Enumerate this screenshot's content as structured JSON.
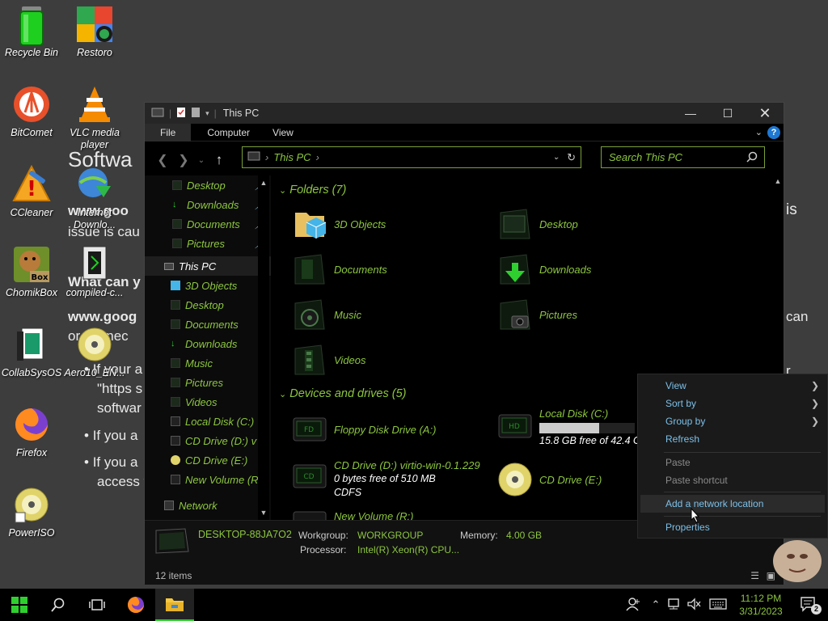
{
  "background": {
    "software": "Softwa",
    "google1": "www.goo",
    "issue": "issue is cau",
    "what": "What can y",
    "google2": "www.goog",
    "connect": "or connec",
    "bullet1": "If your a",
    "https": "\"https s",
    "software2": "softwar",
    "bullet2": "If you a",
    "bullet3": "If you a",
    "access": "access t",
    "right_is": "is",
    "right_can": "can",
    "right_r": "r"
  },
  "desktop_icons": [
    {
      "label": "Recycle Bin",
      "icon": "recycle-bin-icon"
    },
    {
      "label": "Restoro",
      "icon": "restoro-icon"
    },
    {
      "label": "BitComet",
      "icon": "bitcomet-icon"
    },
    {
      "label": "VLC media player",
      "icon": "vlc-icon"
    },
    {
      "label": "CCleaner",
      "icon": "ccleaner-icon"
    },
    {
      "label": "Internet Downlo...",
      "icon": "idm-icon"
    },
    {
      "label": "ChomikBox",
      "icon": "chomikbox-icon"
    },
    {
      "label": "compiled-c...",
      "icon": "compiled-file-icon"
    },
    {
      "label": "CollabSysOS",
      "icon": "collabsys-icon"
    },
    {
      "label": "Aero10_EN...",
      "icon": "disc-image-icon"
    },
    {
      "label": "Firefox",
      "icon": "firefox-icon"
    },
    {
      "label": "PowerISO",
      "icon": "poweriso-icon"
    }
  ],
  "window": {
    "title": "This PC",
    "ribbon_tabs": [
      "File",
      "Computer",
      "View"
    ],
    "address": "This PC",
    "search_placeholder": "Search This PC"
  },
  "nav": {
    "quick_access": [
      {
        "label": "Desktop",
        "pinned": true
      },
      {
        "label": "Downloads",
        "pinned": true
      },
      {
        "label": "Documents",
        "pinned": true
      },
      {
        "label": "Pictures",
        "pinned": true
      }
    ],
    "this_pc": "This PC",
    "this_pc_items": [
      "3D Objects",
      "Desktop",
      "Documents",
      "Downloads",
      "Music",
      "Pictures",
      "Videos",
      "Local Disk (C:)",
      "CD Drive (D:) v",
      "CD Drive (E:)",
      "New Volume (R"
    ],
    "network": "Network"
  },
  "folders": {
    "heading": "Folders (7)",
    "items": [
      "3D Objects",
      "Desktop",
      "Documents",
      "Downloads",
      "Music",
      "Pictures",
      "Videos"
    ]
  },
  "drives": {
    "heading": "Devices and drives (5)",
    "floppy": "Floppy Disk Drive (A:)",
    "local_c": {
      "name": "Local Disk (C:)",
      "free": "15.8 GB free of 42.4 G",
      "used_fraction": 0.63
    },
    "cd_d": {
      "name": "CD Drive (D:) virtio-win-0.1.229",
      "free": "0 bytes free of 510 MB",
      "fs": "CDFS"
    },
    "cd_e": "CD Drive (E:)",
    "new_volume": "New Volume (R:)"
  },
  "details": {
    "computer": "DESKTOP-88JA7O2",
    "workgroup_label": "Workgroup:",
    "workgroup": "WORKGROUP",
    "memory_label": "Memory:",
    "memory": "4.00 GB",
    "processor_label": "Processor:",
    "processor": "Intel(R) Xeon(R) CPU..."
  },
  "status": {
    "items": "12 items"
  },
  "context_menu": {
    "view": "View",
    "sort_by": "Sort by",
    "group_by": "Group by",
    "refresh": "Refresh",
    "paste": "Paste",
    "paste_shortcut": "Paste shortcut",
    "add_network": "Add a network location",
    "properties": "Properties"
  },
  "taskbar": {
    "time": "11:12 PM",
    "date": "3/31/2023",
    "notifications": "2"
  },
  "colors": {
    "accent_green": "#8dc63f",
    "link_blue": "#7cc0e8"
  }
}
